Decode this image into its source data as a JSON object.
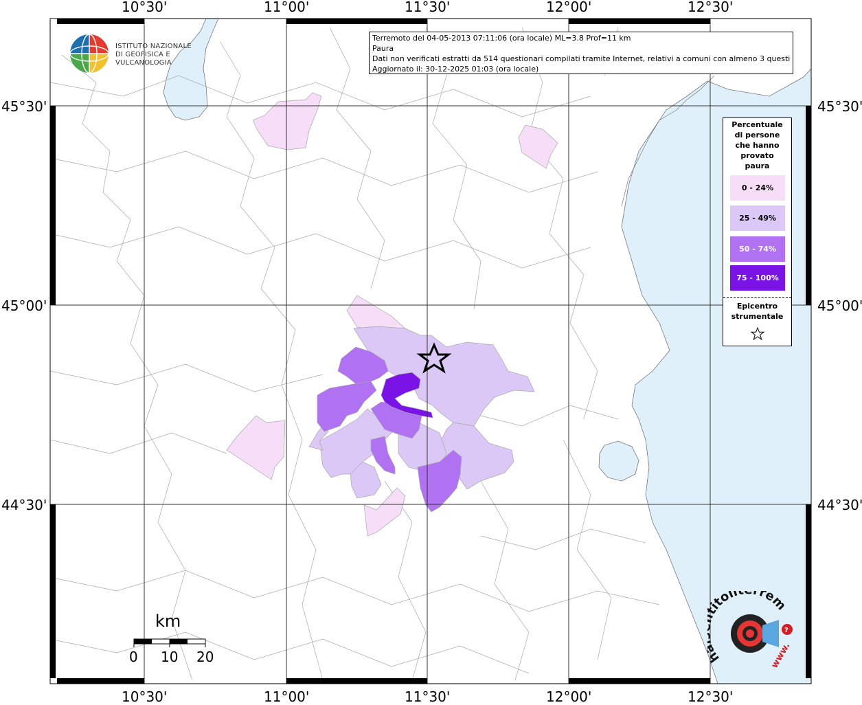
{
  "info": {
    "line1": "Terremoto del 04-05-2013 07:11:06 (ora locale) ML=3.8 Prof=11 km",
    "line2": "Paura",
    "line3": "Dati non verificati estratti da 514 questionari compilati tramite Internet, relativi a comuni con almeno 3 questionari.",
    "line4": "Aggiornato il: 30-12-2025 01:03 (ora locale)"
  },
  "logo": {
    "line1": "ISTITUTO NAZIONALE",
    "line2": "DI GEOFISICA E VULCANOLOGIA"
  },
  "axes": {
    "lon_labels": [
      "10°30'",
      "11°00'",
      "11°30'",
      "12°00'",
      "12°30'"
    ],
    "lat_labels": [
      "45°30'",
      "45°00'",
      "44°30'"
    ]
  },
  "legend": {
    "title_lines": [
      "Percentuale",
      "di persone",
      "che hanno",
      "provato",
      "paura"
    ],
    "classes": [
      {
        "label": "0 - 24%",
        "color": "#f6ddf8",
        "text_color": "#000000"
      },
      {
        "label": "25 - 49%",
        "color": "#dcc8f6",
        "text_color": "#000000"
      },
      {
        "label": "50 - 74%",
        "color": "#b071f2",
        "text_color": "#ffffff"
      },
      {
        "label": "75 - 100%",
        "color": "#7a14e6",
        "text_color": "#ffffff"
      }
    ],
    "epicenter_lines": [
      "Epicentro",
      "strumentale"
    ],
    "epicenter_icon": "star-icon"
  },
  "scale": {
    "title": "km",
    "labels": [
      "0",
      "10",
      "20"
    ]
  },
  "brand": {
    "text": "haisentitoilterremoto.it",
    "www": "www."
  },
  "colors": {
    "sea": "#dff0fa",
    "land": "#ffffff",
    "borders": "#a8a8a8",
    "grid": "#333333"
  },
  "epicenter": {
    "lon": 11.52,
    "lat": 44.92,
    "magnitude_ML": 3.8,
    "depth_km": 11
  }
}
